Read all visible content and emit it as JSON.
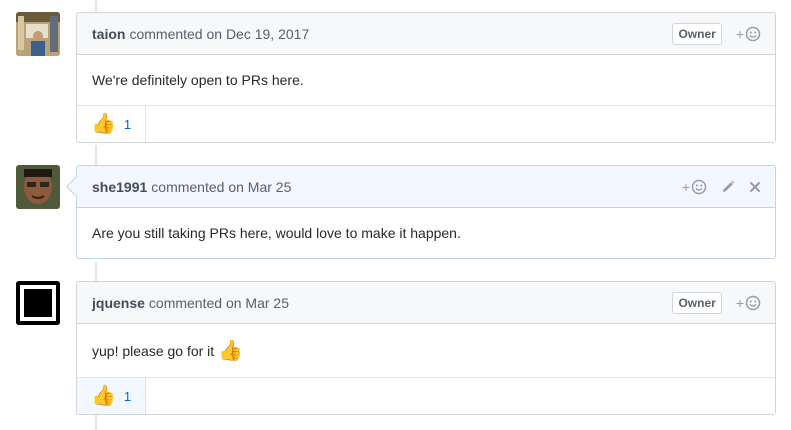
{
  "comments": [
    {
      "author": "taion",
      "meta": "commented on Dec 19, 2017",
      "badge": "Owner",
      "body": "We're definitely open to PRs here.",
      "reaction_emoji": "👍",
      "reaction_count": "1"
    },
    {
      "author": "she1991",
      "meta": "commented on Mar 25",
      "body": "Are you still taking PRs here, would love to make it happen."
    },
    {
      "author": "jquense",
      "meta": "commented on Mar 25",
      "badge": "Owner",
      "body": "yup! please go for it",
      "body_emoji": "👍",
      "reaction_emoji": "👍",
      "reaction_count": "1"
    }
  ],
  "icons": {
    "add_reaction": "smiley-plus-icon",
    "edit": "pencil-icon",
    "delete": "x-icon"
  },
  "colors": {
    "link": "#0366d6",
    "current_user_header": "#f1f8ff",
    "header_bg": "#f6f8fa",
    "border": "#d1d5da"
  }
}
